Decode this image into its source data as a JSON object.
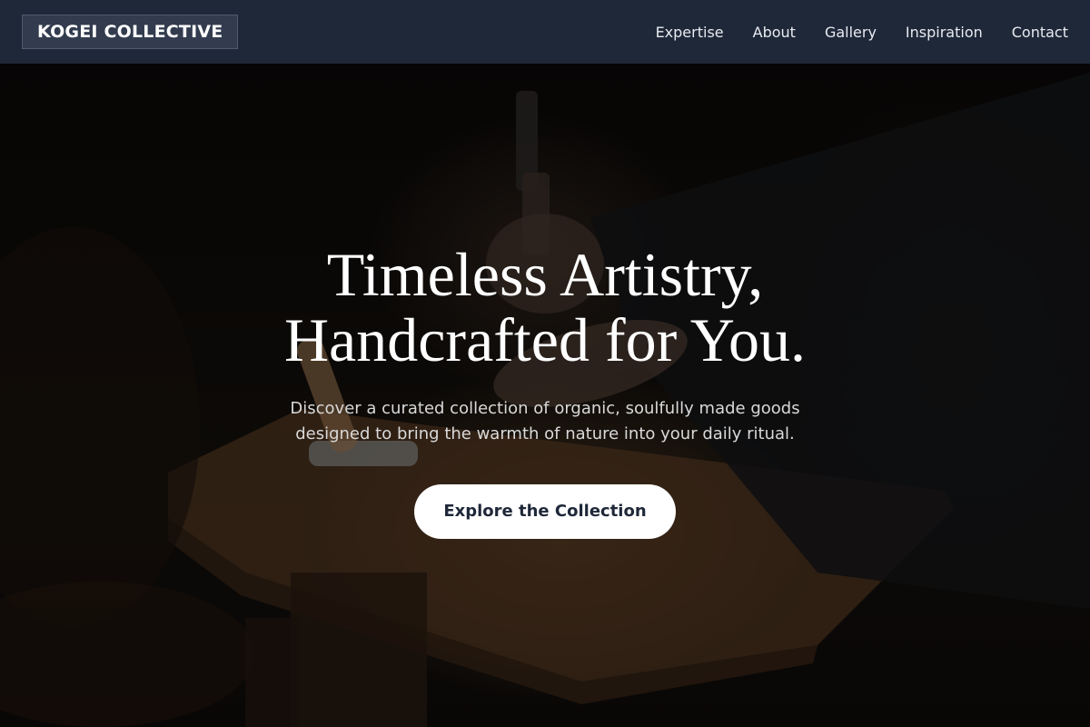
{
  "brand": {
    "name": "KOGEI COLLECTIVE"
  },
  "nav": {
    "items": [
      {
        "label": "Expertise"
      },
      {
        "label": "About"
      },
      {
        "label": "Gallery"
      },
      {
        "label": "Inspiration"
      },
      {
        "label": "Contact"
      }
    ]
  },
  "hero": {
    "headline_line1": "Timeless Artistry,",
    "headline_line2": "Handcrafted for You.",
    "subtext_line1": "Discover a curated collection of organic, soulfully made goods",
    "subtext_line2": "designed to bring the warmth of nature into your daily ritual.",
    "cta_label": "Explore the Collection"
  },
  "colors": {
    "header_bg": "#1f2839",
    "cta_bg": "#ffffff",
    "cta_text": "#1f2839"
  }
}
